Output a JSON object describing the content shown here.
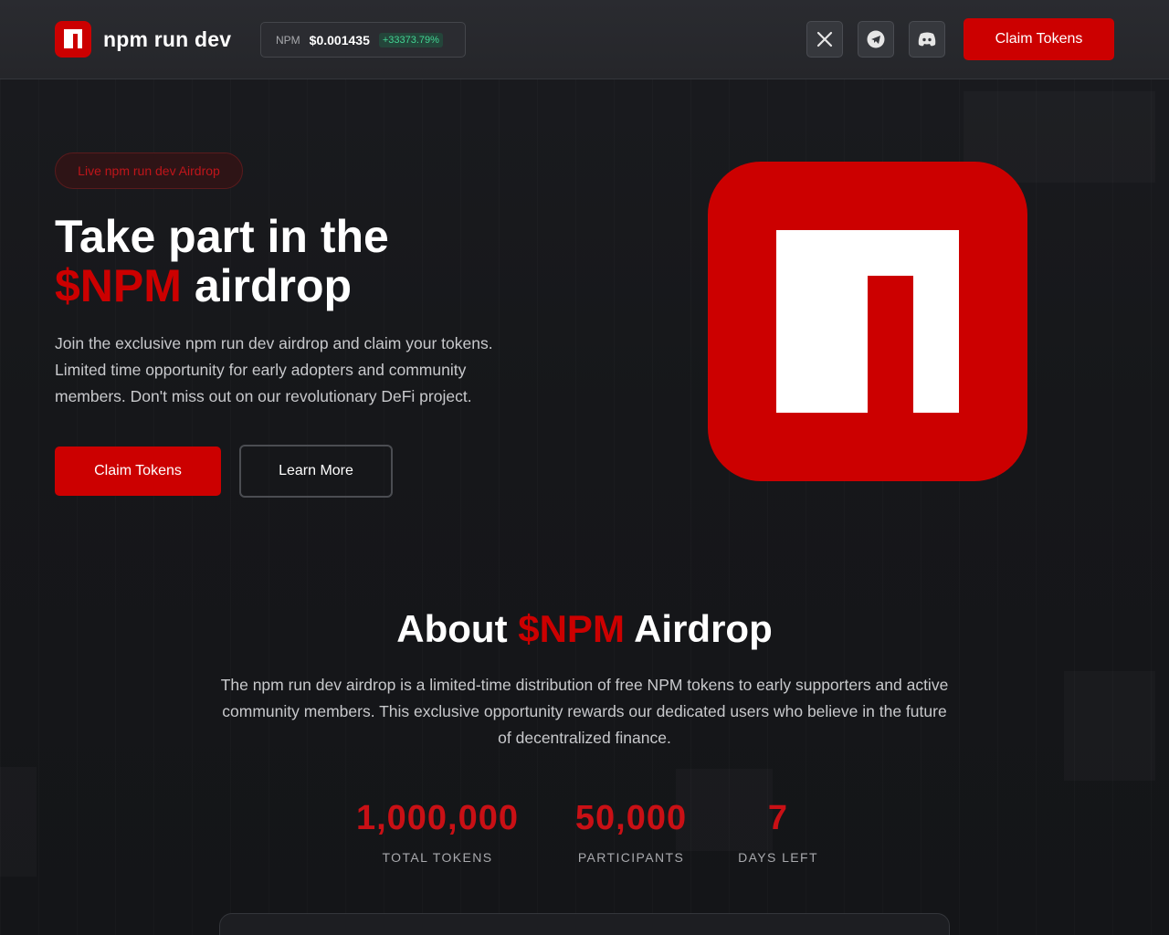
{
  "nav": {
    "brand": "npm run dev",
    "ticker": {
      "symbol": "NPM",
      "price": "$0.001435",
      "change": "+33373.79%"
    },
    "social": [
      "x-icon",
      "telegram-icon",
      "discord-icon"
    ],
    "claim_label": "Claim Tokens"
  },
  "hero": {
    "badge": "Live npm run dev Airdrop",
    "title_line1": "Take part in the",
    "title_accent": "$NPM",
    "title_rest": "airdrop",
    "description": "Join the exclusive npm run dev airdrop and claim your tokens. Limited time opportunity for early adopters and community members. Don't miss out on our revolutionary DeFi project.",
    "claim_label": "Claim Tokens",
    "learn_label": "Learn More"
  },
  "about": {
    "title_pre": "About",
    "title_accent": "$NPM",
    "title_post": "Airdrop",
    "description": "The npm run dev airdrop is a limited-time distribution of free NPM tokens to early supporters and active community members. This exclusive opportunity rewards our dedicated users who believe in the future of decentralized finance.",
    "stats": [
      {
        "value": "1,000,000",
        "label": "TOTAL TOKENS"
      },
      {
        "value": "50,000",
        "label": "PARTICIPANTS"
      },
      {
        "value": "7",
        "label": "DAYS LEFT"
      }
    ]
  },
  "colors": {
    "accent": "#cc0000",
    "background": "#141518",
    "positive": "#42d392"
  }
}
